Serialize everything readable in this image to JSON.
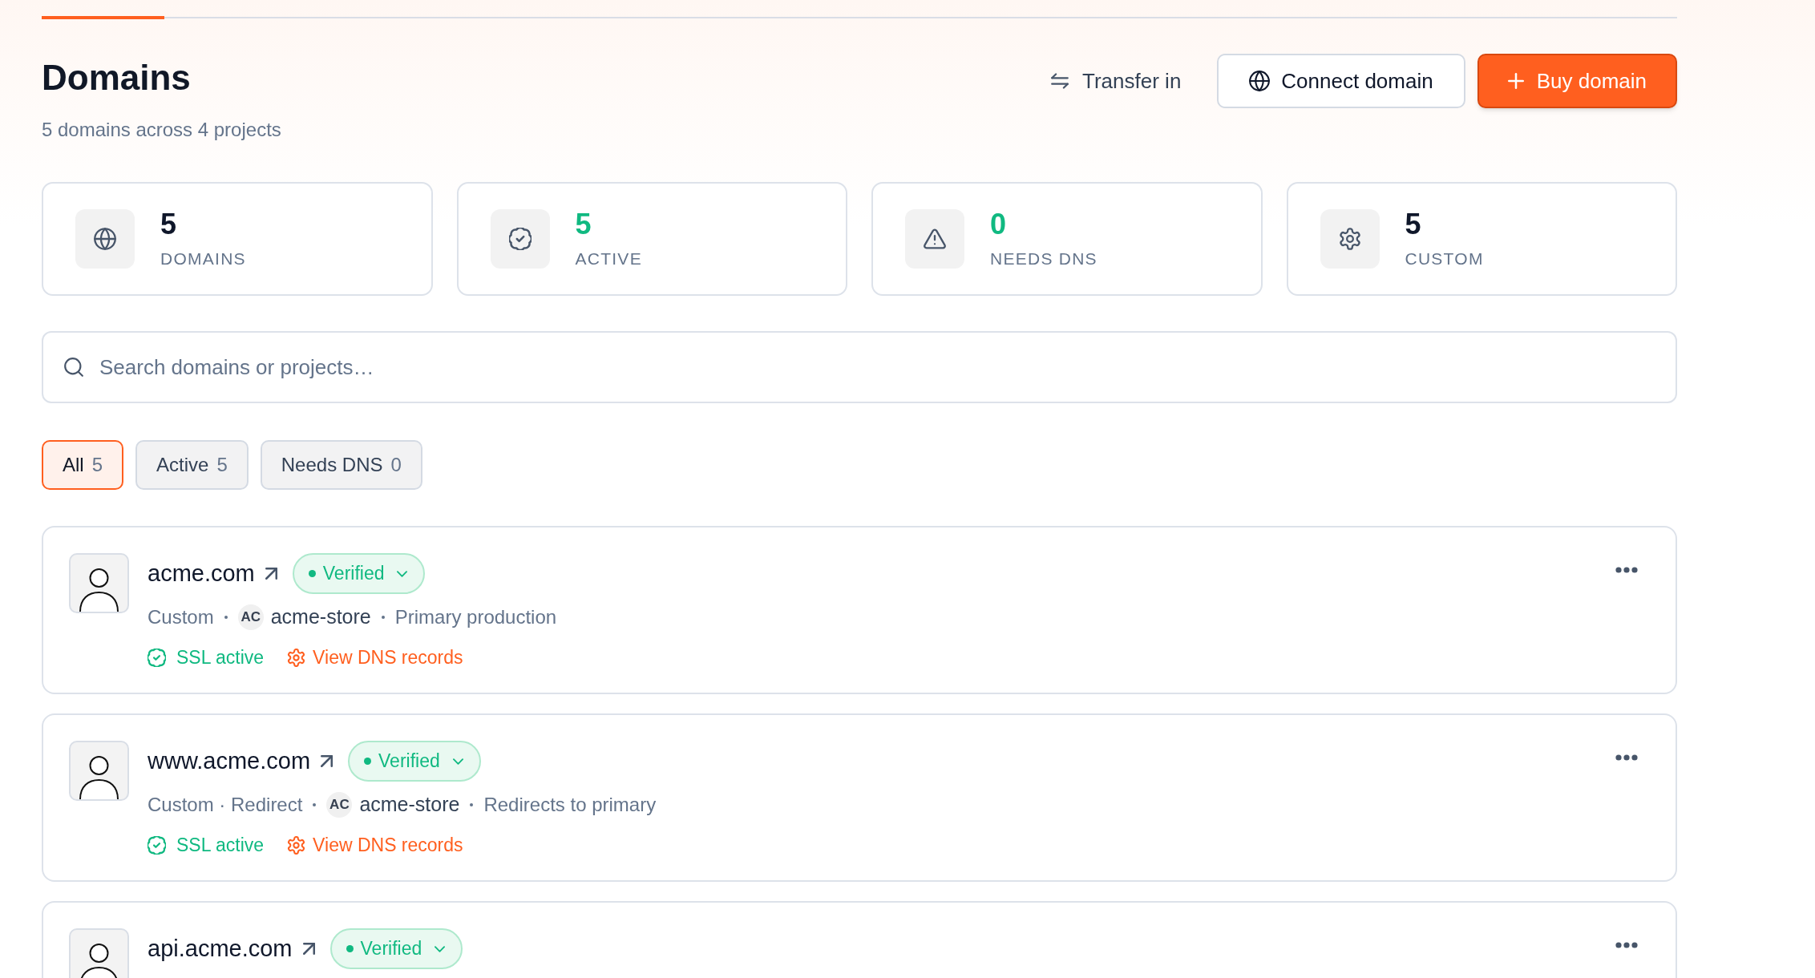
{
  "progress": {
    "level": 0.075
  },
  "header": {
    "title": "Domains",
    "subtitle": "5 domains across 4 projects",
    "actions": [
      {
        "kind": "ghost",
        "label": "Transfer in"
      },
      {
        "kind": "outline",
        "label": "Connect domain"
      },
      {
        "kind": "primary",
        "label": "Buy domain"
      }
    ]
  },
  "stats": [
    {
      "value": "5",
      "label": "DOMAINS",
      "color": "#0f172a"
    },
    {
      "value": "5",
      "label": "ACTIVE",
      "color": "#10b981"
    },
    {
      "value": "0",
      "label": "NEEDS DNS",
      "color": "#10b981"
    },
    {
      "value": "5",
      "label": "CUSTOM",
      "color": "#0f172a"
    }
  ],
  "search": {
    "placeholder": "Search domains or projects…"
  },
  "filters": [
    {
      "label": "All",
      "count": "5",
      "selected": true
    },
    {
      "label": "Active",
      "count": "5",
      "selected": false
    },
    {
      "label": "Needs DNS",
      "count": "0",
      "selected": false
    }
  ],
  "domains": [
    {
      "name": "acme.com",
      "status": "Verified",
      "type": "Custom",
      "project": {
        "initials": "AC",
        "name": "acme-store"
      },
      "note": "Primary production",
      "ssl": "SSL active",
      "dns_link": "View DNS records"
    },
    {
      "name": "www.acme.com",
      "status": "Verified",
      "type": "Custom · Redirect",
      "project": {
        "initials": "AC",
        "name": "acme-store"
      },
      "note": "Redirects to primary",
      "ssl": "SSL active",
      "dns_link": "View DNS records"
    },
    {
      "name": "api.acme.com",
      "status": "Verified"
    }
  ]
}
